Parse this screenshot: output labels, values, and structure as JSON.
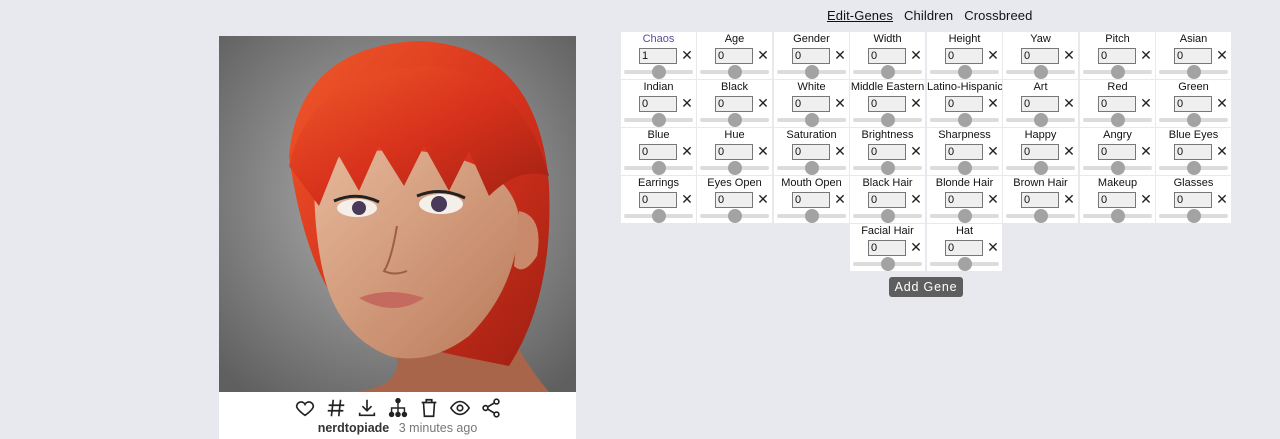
{
  "tabs": [
    {
      "label": "Edit-Genes",
      "active": true
    },
    {
      "label": "Children",
      "active": false
    },
    {
      "label": "Crossbreed",
      "active": false
    }
  ],
  "genes": [
    {
      "label": "Chaos",
      "value": "1",
      "level": 0.5
    },
    {
      "label": "Age",
      "value": "0",
      "level": 0.5
    },
    {
      "label": "Gender",
      "value": "0",
      "level": 0.5
    },
    {
      "label": "Width",
      "value": "0",
      "level": 0.5
    },
    {
      "label": "Height",
      "value": "0",
      "level": 0.5
    },
    {
      "label": "Yaw",
      "value": "0",
      "level": 0.5
    },
    {
      "label": "Pitch",
      "value": "0",
      "level": 0.5
    },
    {
      "label": "Asian",
      "value": "0",
      "level": 0.5
    },
    {
      "label": "Indian",
      "value": "0",
      "level": 0.5
    },
    {
      "label": "Black",
      "value": "0",
      "level": 0.5
    },
    {
      "label": "White",
      "value": "0",
      "level": 0.5
    },
    {
      "label": "Middle Eastern",
      "value": "0",
      "level": 0.5
    },
    {
      "label": "Latino-Hispanic",
      "value": "0",
      "level": 0.5
    },
    {
      "label": "Art",
      "value": "0",
      "level": 0.5
    },
    {
      "label": "Red",
      "value": "0",
      "level": 0.5
    },
    {
      "label": "Green",
      "value": "0",
      "level": 0.5
    },
    {
      "label": "Blue",
      "value": "0",
      "level": 0.5
    },
    {
      "label": "Hue",
      "value": "0",
      "level": 0.5
    },
    {
      "label": "Saturation",
      "value": "0",
      "level": 0.5
    },
    {
      "label": "Brightness",
      "value": "0",
      "level": 0.5
    },
    {
      "label": "Sharpness",
      "value": "0",
      "level": 0.5
    },
    {
      "label": "Happy",
      "value": "0",
      "level": 0.5
    },
    {
      "label": "Angry",
      "value": "0",
      "level": 0.5
    },
    {
      "label": "Blue Eyes",
      "value": "0",
      "level": 0.5
    },
    {
      "label": "Earrings",
      "value": "0",
      "level": 0.5
    },
    {
      "label": "Eyes Open",
      "value": "0",
      "level": 0.5
    },
    {
      "label": "Mouth Open",
      "value": "0",
      "level": 0.5
    },
    {
      "label": "Black Hair",
      "value": "0",
      "level": 0.5
    },
    {
      "label": "Blonde Hair",
      "value": "0",
      "level": 0.5
    },
    {
      "label": "Brown Hair",
      "value": "0",
      "level": 0.5
    },
    {
      "label": "Makeup",
      "value": "0",
      "level": 0.5
    },
    {
      "label": "Glasses",
      "value": "0",
      "level": 0.5
    },
    {
      "label": "Facial Hair",
      "value": "0",
      "level": 0.5
    },
    {
      "label": "Hat",
      "value": "0",
      "level": 0.5
    }
  ],
  "remove_glyph": "✕",
  "add_gene_label": "Add Gene",
  "card": {
    "username": "nerdtopiade",
    "timestamp": "3 minutes ago",
    "actions": [
      "heart-icon",
      "hash-icon",
      "download-icon",
      "family-tree-icon",
      "trash-icon",
      "eye-icon",
      "share-icon"
    ]
  },
  "colors": {
    "background": "#e7e9ee",
    "accent_label": "#5b4a9c",
    "button": "#5e5e5e",
    "hair": "#d8321c"
  }
}
